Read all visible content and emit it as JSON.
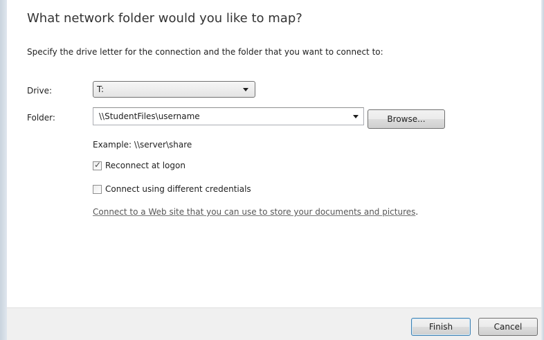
{
  "dialog": {
    "heading": "What network folder would you like to map?",
    "instructions": "Specify the drive letter for the connection and the folder that you want to connect to:"
  },
  "drive": {
    "label": "Drive:",
    "selected": "T:"
  },
  "folder": {
    "label": "Folder:",
    "value": "\\\\StudentFiles\\username",
    "browse_label": "Browse...",
    "example": "Example: \\\\server\\share"
  },
  "options": {
    "reconnect": {
      "label": "Reconnect at logon",
      "checked": true
    },
    "credentials": {
      "label": "Connect using different credentials",
      "checked": false
    }
  },
  "web_link": {
    "text": "Connect to a Web site that you can use to store your documents and pictures",
    "suffix": "."
  },
  "footer": {
    "finish_label": "Finish",
    "cancel_label": "Cancel"
  },
  "icons": {
    "dropdown": "chevron-down-icon",
    "checkmark": "checkmark-icon"
  },
  "colors": {
    "footer_bg": "#f0f0f0",
    "default_button_border": "#3c7fb1",
    "link_text": "#555555"
  }
}
